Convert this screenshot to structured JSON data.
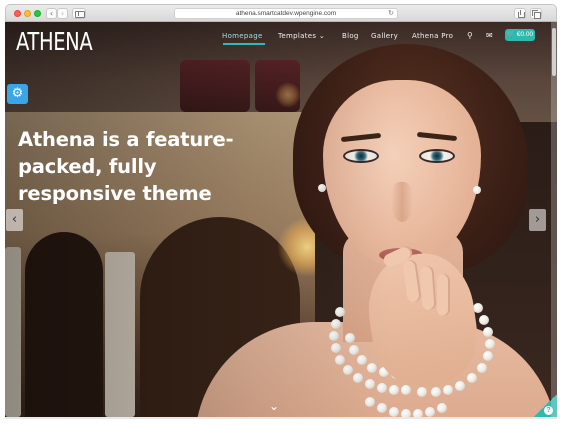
{
  "browser": {
    "url": "athena.smartcatdev.wpengine.com"
  },
  "site": {
    "logo": "ATHENA",
    "nav": {
      "homepage": "Homepage",
      "templates": "Templates ⌄",
      "blog": "Blog",
      "gallery": "Gallery",
      "pro": "Athena Pro"
    },
    "cart_label": " €0.00"
  },
  "hero": {
    "title": "Athena is a feature-packed, fully responsive theme"
  },
  "icons": {
    "search": "search-icon",
    "mail": "mail-icon",
    "cart": "cart-icon",
    "gear": "gear-icon",
    "prev": "chevron-left-icon",
    "next": "chevron-right-icon",
    "scroll": "chevron-down-icon",
    "help": "help-icon"
  },
  "colors": {
    "accent": "#2fb9ae",
    "settings_tab": "#3aa6e6",
    "nav_active": "#a7dee0"
  }
}
